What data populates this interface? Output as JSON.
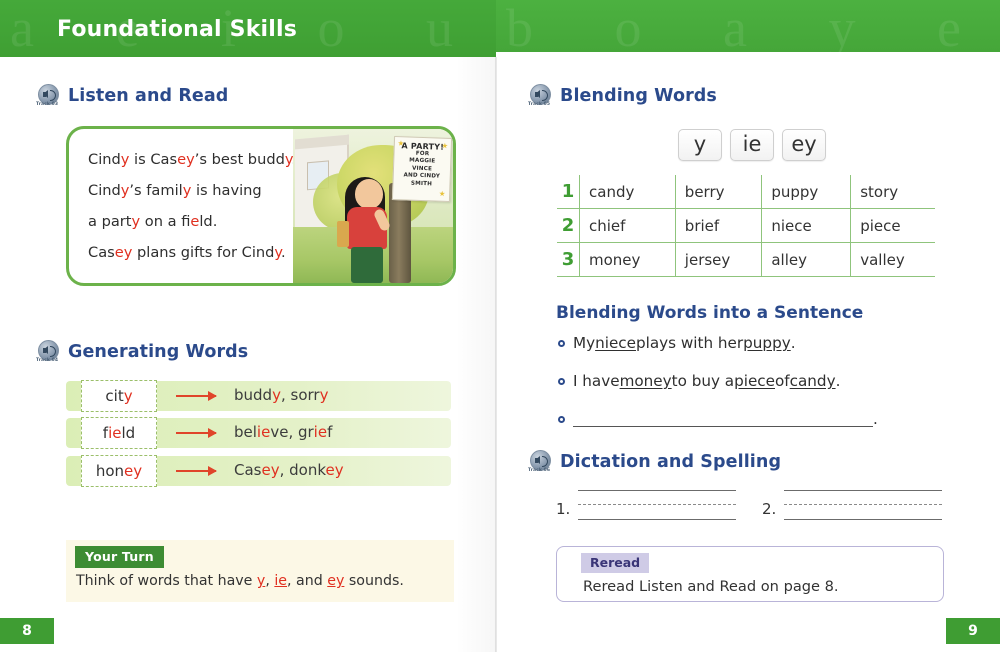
{
  "header": {
    "title": "Foundational Skills"
  },
  "left_page": {
    "page_number": "8",
    "listen_and_read": {
      "heading": "Listen and Read",
      "track": "Track 03",
      "icon": "audio-speaker-icon",
      "lines": [
        [
          {
            "t": "Cind",
            "hl": false
          },
          {
            "t": "y",
            "hl": true
          },
          {
            "t": " is Cas",
            "hl": false
          },
          {
            "t": "ey",
            "hl": true
          },
          {
            "t": "’s best budd",
            "hl": false
          },
          {
            "t": "y",
            "hl": true
          },
          {
            "t": ".",
            "hl": false
          }
        ],
        [
          {
            "t": "Cind",
            "hl": false
          },
          {
            "t": "y",
            "hl": true
          },
          {
            "t": "’s famil",
            "hl": false
          },
          {
            "t": "y",
            "hl": true
          },
          {
            "t": " is having",
            "hl": false
          }
        ],
        [
          {
            "t": "a part",
            "hl": false
          },
          {
            "t": "y",
            "hl": true
          },
          {
            "t": " on a f",
            "hl": false
          },
          {
            "t": "ie",
            "hl": true
          },
          {
            "t": "ld.",
            "hl": false
          }
        ],
        [
          {
            "t": "Cas",
            "hl": false
          },
          {
            "t": "ey",
            "hl": true
          },
          {
            "t": " plans gifts for Cind",
            "hl": false
          },
          {
            "t": "y",
            "hl": true
          },
          {
            "t": ".",
            "hl": false
          }
        ]
      ],
      "illustration": {
        "description": "girl-looking-at-party-poster-illustration",
        "poster_lines": [
          "A PARTY!",
          "FOR",
          "MAGGIE",
          "VINCE",
          "AND CINDY",
          "SMITH"
        ]
      }
    },
    "generating_words": {
      "heading": "Generating Words",
      "track": "Track 04",
      "icon": "audio-speaker-icon",
      "rows": [
        {
          "word": [
            {
              "t": "cit",
              "hl": false
            },
            {
              "t": "y",
              "hl": true
            }
          ],
          "results": [
            {
              "t": "budd",
              "hl": false
            },
            {
              "t": "y",
              "hl": true
            },
            {
              "t": ", sorr",
              "hl": false
            },
            {
              "t": "y",
              "hl": true
            }
          ]
        },
        {
          "word": [
            {
              "t": "f",
              "hl": false
            },
            {
              "t": "ie",
              "hl": true
            },
            {
              "t": "ld",
              "hl": false
            }
          ],
          "results": [
            {
              "t": "bel",
              "hl": false
            },
            {
              "t": "ie",
              "hl": true
            },
            {
              "t": "ve",
              "hl": false
            },
            {
              "t": ", gr",
              "hl": false
            },
            {
              "t": "ie",
              "hl": true
            },
            {
              "t": "f",
              "hl": false
            }
          ]
        },
        {
          "word": [
            {
              "t": "hon",
              "hl": false
            },
            {
              "t": "ey",
              "hl": true
            }
          ],
          "results": [
            {
              "t": "Cas",
              "hl": false
            },
            {
              "t": "ey",
              "hl": true
            },
            {
              "t": ", donk",
              "hl": false
            },
            {
              "t": "ey",
              "hl": true
            }
          ]
        }
      ]
    },
    "your_turn": {
      "label": "Your Turn",
      "text_parts": [
        {
          "t": "Think of words that have ",
          "hl": false
        },
        {
          "t": "y",
          "hl": true
        },
        {
          "t": ", ",
          "hl": false
        },
        {
          "t": "ie",
          "hl": true
        },
        {
          "t": ", and ",
          "hl": false
        },
        {
          "t": "ey",
          "hl": true
        },
        {
          "t": " sounds.",
          "hl": false
        }
      ]
    }
  },
  "right_page": {
    "page_number": "9",
    "blending_words": {
      "heading": "Blending Words",
      "track": "Track 05",
      "icon": "audio-speaker-icon",
      "chips": [
        "y",
        "ie",
        "ey"
      ],
      "rows": [
        {
          "num": "1",
          "words": [
            "candy",
            "berry",
            "puppy",
            "story"
          ]
        },
        {
          "num": "2",
          "words": [
            "chief",
            "brief",
            "niece",
            "piece"
          ]
        },
        {
          "num": "3",
          "words": [
            "money",
            "jersey",
            "alley",
            "valley"
          ]
        }
      ]
    },
    "blending_sentence": {
      "heading": "Blending Words into a Sentence",
      "items": [
        [
          {
            "t": "My ",
            "u": false
          },
          {
            "t": "niece",
            "u": true
          },
          {
            "t": " plays with her ",
            "u": false
          },
          {
            "t": "puppy",
            "u": true
          },
          {
            "t": ".",
            "u": false
          }
        ],
        [
          {
            "t": "I have ",
            "u": false
          },
          {
            "t": "money",
            "u": true
          },
          {
            "t": " to buy a ",
            "u": false
          },
          {
            "t": "piece",
            "u": true
          },
          {
            "t": " of ",
            "u": false
          },
          {
            "t": "candy",
            "u": true
          },
          {
            "t": ".",
            "u": false
          }
        ],
        "blank"
      ]
    },
    "dictation": {
      "heading": "Dictation and Spelling",
      "track": "Track 06",
      "icon": "audio-speaker-icon",
      "items": [
        {
          "label": "1."
        },
        {
          "label": "2."
        }
      ]
    },
    "reread": {
      "label": "Reread",
      "text": "Reread Listen and Read on page 8."
    }
  },
  "colors": {
    "brand_green": "#43a437",
    "heading_blue": "#2b4a8b",
    "highlight_red": "#e03020",
    "band_light_green": "#dbeeb6",
    "cream": "#fcf8e6",
    "lavender": "#cfcbe6"
  }
}
